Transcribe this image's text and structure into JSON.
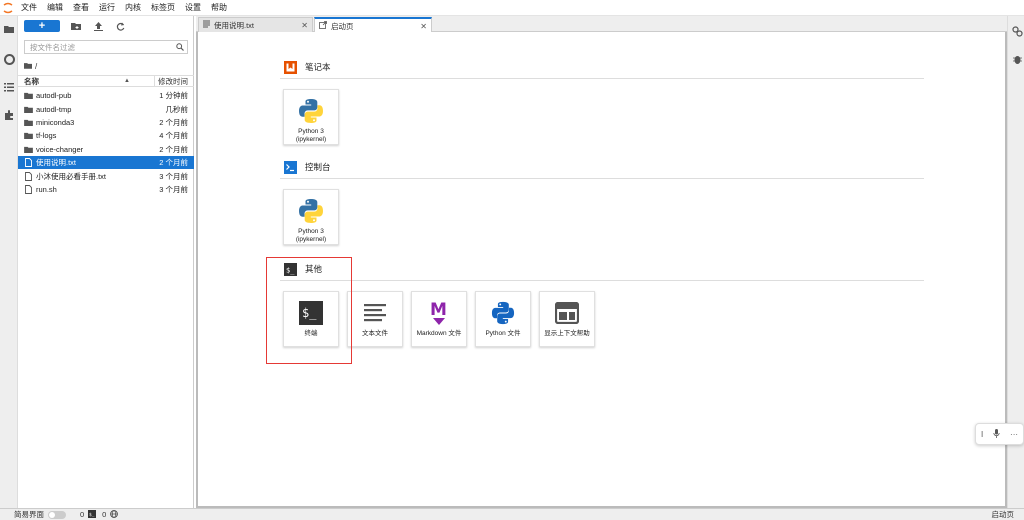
{
  "menubar": {
    "items": [
      "文件",
      "编辑",
      "查看",
      "运行",
      "内核",
      "标签页",
      "设置",
      "帮助"
    ]
  },
  "sidebar": {
    "icons": [
      "folder-icon",
      "running-icon",
      "toc-icon",
      "extensions-icon"
    ]
  },
  "right_sidebar": {
    "icons": [
      "property-inspector-icon",
      "debugger-icon"
    ]
  },
  "filebrowser": {
    "new_label": "+",
    "filter_placeholder": "按文件名过滤",
    "breadcrumb": "/",
    "header_name": "名称",
    "header_modified": "修改时间",
    "files": [
      {
        "name": "autodl-pub",
        "time": "1 分钟前",
        "type": "folder",
        "selected": false
      },
      {
        "name": "autodl-tmp",
        "time": "几秒前",
        "type": "folder",
        "selected": false
      },
      {
        "name": "miniconda3",
        "time": "2 个月前",
        "type": "folder",
        "selected": false
      },
      {
        "name": "tf-logs",
        "time": "4 个月前",
        "type": "folder",
        "selected": false
      },
      {
        "name": "voice-changer",
        "time": "2 个月前",
        "type": "folder",
        "selected": false
      },
      {
        "name": "使用说明.txt",
        "time": "2 个月前",
        "type": "file",
        "selected": true
      },
      {
        "name": "小沐使用必看手册.txt",
        "time": "3 个月前",
        "type": "file",
        "selected": false
      },
      {
        "name": "run.sh",
        "time": "3 个月前",
        "type": "file",
        "selected": false
      }
    ]
  },
  "tabs": [
    {
      "label": "使用说明.txt",
      "active": false
    },
    {
      "label": "启动页",
      "active": true
    }
  ],
  "launcher": {
    "sections": [
      {
        "title": "笔记本",
        "cards": [
          {
            "label": "Python 3\n(ipykernel)",
            "icon": "python-icon"
          }
        ]
      },
      {
        "title": "控制台",
        "cards": [
          {
            "label": "Python 3\n(ipykernel)",
            "icon": "python-icon"
          }
        ]
      },
      {
        "title": "其他",
        "cards": [
          {
            "label": "终端",
            "icon": "terminal-icon"
          },
          {
            "label": "文本文件",
            "icon": "text-file-icon"
          },
          {
            "label": "Markdown 文件",
            "icon": "markdown-icon"
          },
          {
            "label": "Python 文件",
            "icon": "python-icon"
          },
          {
            "label": "显示上下文帮助",
            "icon": "contextual-help-icon"
          }
        ]
      }
    ]
  },
  "floatbar": {
    "items": [
      "I",
      "mic-icon",
      "···"
    ]
  },
  "statusbar": {
    "simple_mode": "简易界面",
    "kernels_count": "0",
    "terminals_count": "0",
    "right_label": "启动页"
  },
  "colors": {
    "accent": "#1976d2",
    "notebook_icon": "#e65100",
    "console_icon": "#1976d2",
    "highlight_box": "#e53935",
    "markdown_purple": "#8e24aa"
  }
}
